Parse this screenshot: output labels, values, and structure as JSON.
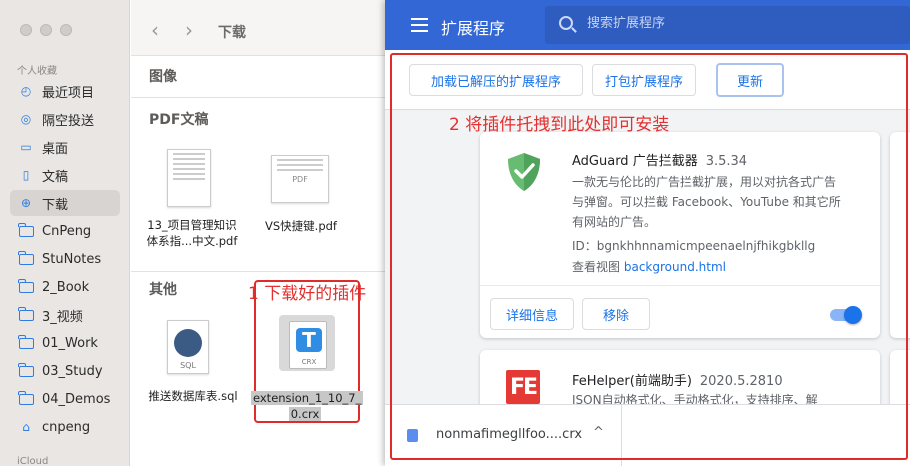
{
  "finder": {
    "title": "下载",
    "nav_back": "‹",
    "nav_forward": "›",
    "sidebar_section": "个人收藏",
    "sidebar_section_icloud": "iCloud",
    "sidebar": [
      {
        "label": "最近项目",
        "icon": "clock-icon"
      },
      {
        "label": "隔空投送",
        "icon": "airdrop-icon"
      },
      {
        "label": "桌面",
        "icon": "desktop-icon"
      },
      {
        "label": "文稿",
        "icon": "document-icon"
      },
      {
        "label": "下载",
        "icon": "download-icon"
      },
      {
        "label": "CnPeng",
        "icon": "folder-icon"
      },
      {
        "label": "StuNotes",
        "icon": "folder-icon"
      },
      {
        "label": "2_Book",
        "icon": "folder-icon"
      },
      {
        "label": "3_视频",
        "icon": "folder-icon"
      },
      {
        "label": "01_Work",
        "icon": "folder-icon"
      },
      {
        "label": "03_Study",
        "icon": "folder-icon"
      },
      {
        "label": "04_Demos",
        "icon": "folder-icon"
      },
      {
        "label": "cnpeng",
        "icon": "home-icon"
      }
    ],
    "sections": {
      "images": "图像",
      "pdf": "PDF文稿",
      "other": "其他"
    },
    "files": {
      "pdf1": [
        "13_项目管理知识",
        "体系指...中文.pdf"
      ],
      "pdf2": "VS快捷键.pdf",
      "pdf_label": "PDF",
      "sql": "推送数据库表.sql",
      "sql_label": "SQL",
      "crx": [
        "extension_1_10_7_",
        "0.crx"
      ],
      "crx_label": "CRX"
    },
    "annotation": "1 下载好的插件"
  },
  "extensions": {
    "title": "扩展程序",
    "search_placeholder": "搜索扩展程序",
    "buttons": {
      "load_unpacked": "加载已解压的扩展程序",
      "pack": "打包扩展程序",
      "update": "更新"
    },
    "annotation": "2 将插件托拽到此处即可安装",
    "cards": [
      {
        "name": "AdGuard 广告拦截器",
        "version": "3.5.34",
        "desc": [
          "一款无与伦比的广告拦截扩展，用以对抗各式广告",
          "与弹窗。可以拦截 Facebook、YouTube 和其它所",
          "有网站的广告。"
        ],
        "id_label": "ID：",
        "id": "bgnkhhnnamicmpeenaelnjfhikgbkllg",
        "view_label": "查看视图",
        "view_link": "background.html",
        "details": "详细信息",
        "remove": "移除",
        "enabled": true
      },
      {
        "name": "FeHelper(前端助手)",
        "version": "2020.5.2810",
        "desc": [
          "JSON自动格式化、手动格式化，支持排序、解"
        ]
      }
    ],
    "download": {
      "filename": "nonmafimegllfoo....crx",
      "chevron": "^"
    }
  },
  "colors": {
    "accent": "#3367d6",
    "annotation": "#e53030",
    "link": "#1a73e8"
  }
}
